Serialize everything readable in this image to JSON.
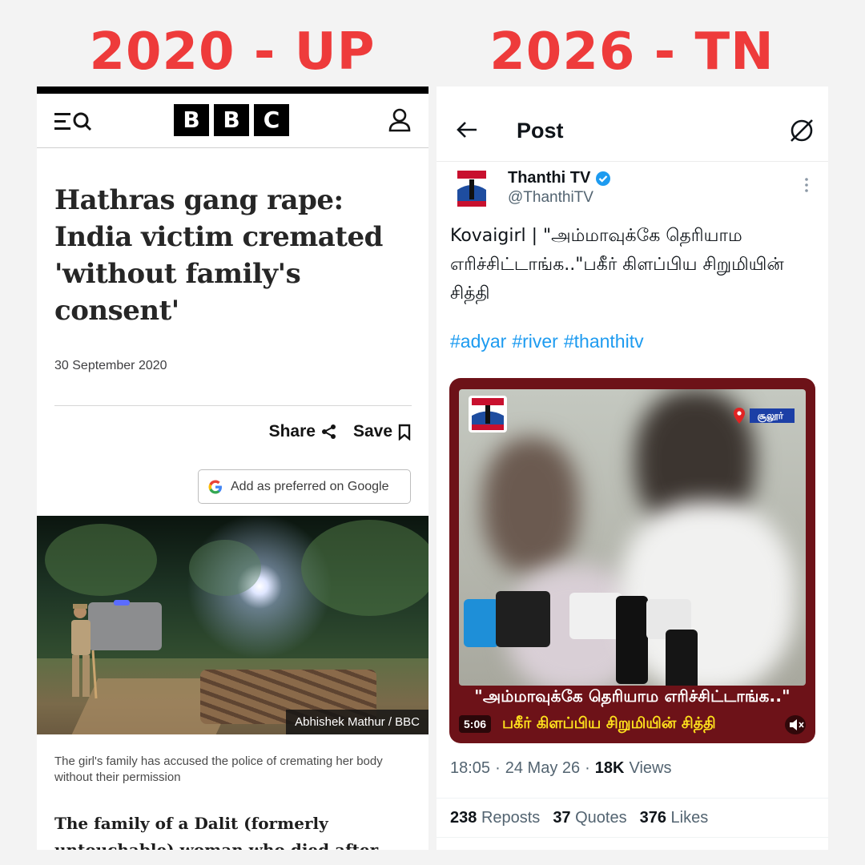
{
  "headings": {
    "left": "2020 - UP",
    "right": "2026 - TN"
  },
  "bbc": {
    "logo": [
      "B",
      "B",
      "C"
    ],
    "headline": "Hathras gang rape: India victim cremated 'without family's consent'",
    "date": "30 September 2020",
    "share_label": "Share",
    "save_label": "Save",
    "google_button": "Add as preferred on Google",
    "photo_credit": "Abhishek Mathur / BBC",
    "caption": "The girl's family has accused the police of cremating her body without their permission",
    "body_text": "The family of a Dalit (formerly untouchable) woman who died after she"
  },
  "x": {
    "title": "Post",
    "account_name": "Thanthi TV",
    "handle": "@ThanthiTV",
    "tweet_text": "Kovaigirl | \"அம்மாவுக்கே தெரியாம எரிச்சிட்டாங்க..\"பகீர் கிளப்பிய சிறுமியின் சித்தி",
    "hashtags": [
      "#adyar",
      "#river",
      "#thanthitv"
    ],
    "video": {
      "location": "சூலூர்",
      "caption_line1": "\"அம்மாவுக்கே தெரியாம எரிச்சிட்டாங்க..\"",
      "caption_line2": "பகீர் கிளப்பிய சிறுமியின் சித்தி",
      "duration": "5:06"
    },
    "time": "18:05",
    "date": "24 May 26",
    "views_count": "18K",
    "views_label": "Views",
    "reposts_count": "238",
    "reposts_label": "Reposts",
    "quotes_count": "37",
    "quotes_label": "Quotes",
    "likes_count": "376",
    "likes_label": "Likes"
  },
  "colors": {
    "heading_red": "#ee3b3b",
    "bbc_black": "#000000",
    "x_blue": "#1d9bf0",
    "video_frame": "#6d1218",
    "caption_yellow": "#ffe21c"
  }
}
